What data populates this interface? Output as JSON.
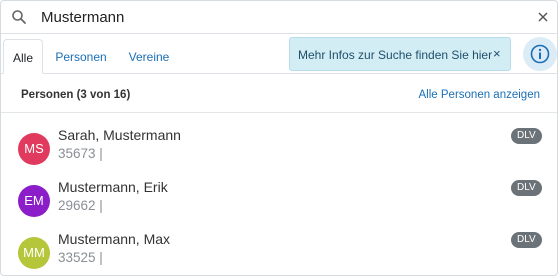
{
  "search": {
    "value": "Mustermann"
  },
  "tabs": [
    {
      "label": "Alle"
    },
    {
      "label": "Personen"
    },
    {
      "label": "Vereine"
    }
  ],
  "info_banner": {
    "text": "Mehr Infos zur Suche finden Sie hier",
    "close": "×"
  },
  "section": {
    "title": "Personen (3 von 16)",
    "link": "Alle Personen anzeigen"
  },
  "results": [
    {
      "initials": "MS",
      "name": "Sarah, Mustermann",
      "sub": "35673 |",
      "badge": "DLV",
      "color": "#e03a5e"
    },
    {
      "initials": "EM",
      "name": "Mustermann, Erik",
      "sub": "29662 |",
      "badge": "DLV",
      "color": "#8b1ec9"
    },
    {
      "initials": "MM",
      "name": "Mustermann, Max",
      "sub": "33525 |",
      "badge": "DLV",
      "color": "#b5c63a"
    }
  ],
  "colors": {
    "accent": "#1a6fb5",
    "banner_bg": "#d3edf5",
    "badge_bg": "#6c7378"
  },
  "icons": {
    "search": "search-icon",
    "clear": "close-icon",
    "info": "info-icon"
  }
}
